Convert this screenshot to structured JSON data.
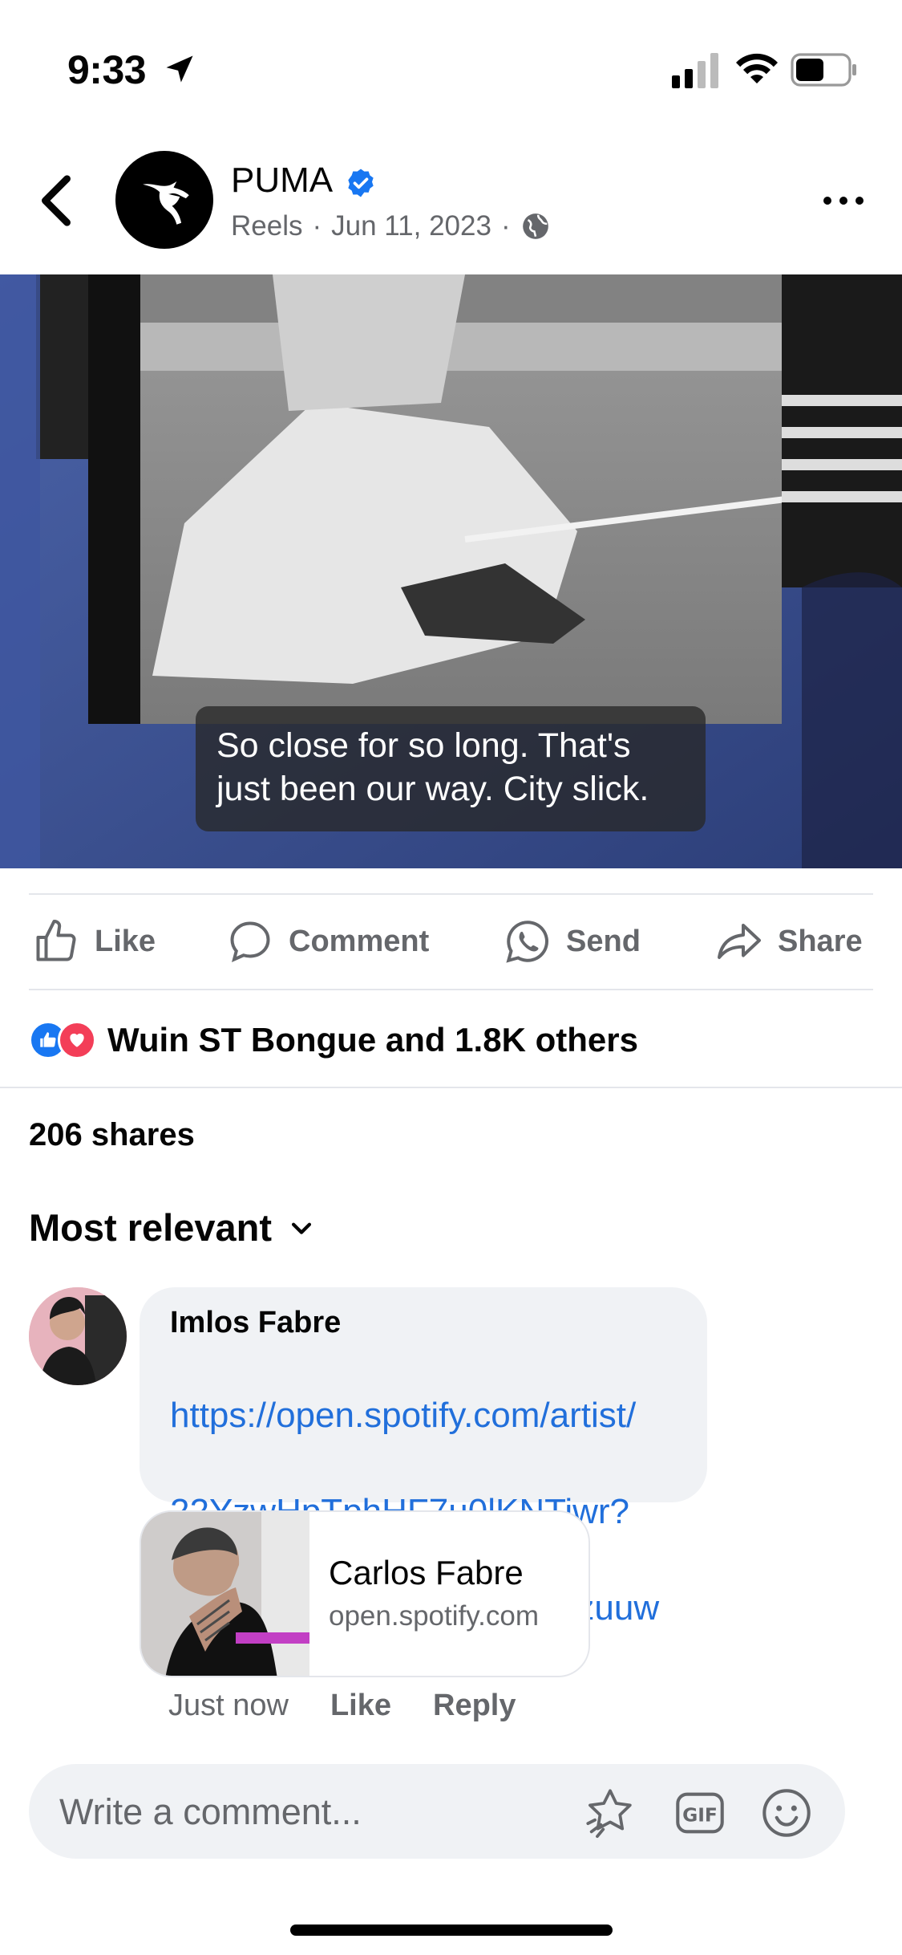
{
  "status_bar": {
    "time": "9:33"
  },
  "post": {
    "page_name": "PUMA",
    "source": "Reels",
    "date": "Jun 11, 2023",
    "separator": "·"
  },
  "video": {
    "caption_line1": "So close for so long. That's",
    "caption_line2": "just been our way. City slick."
  },
  "actions": {
    "like": "Like",
    "comment": "Comment",
    "send": "Send",
    "share": "Share"
  },
  "reactions": {
    "text": "Wuin ST Bongue and 1.8K others"
  },
  "shares": "206 shares",
  "sort": {
    "label": "Most relevant"
  },
  "comment": {
    "author": "Imlos Fabre",
    "link_line1": "https://open.spotify.com/artist/",
    "link_line2": "22YzwHpTphHF7u0lKNTiwr?",
    "link_line3": "si=KqTBcVetR9OtyKPMipzuuw",
    "preview_title": "Carlos Fabre",
    "preview_domain": "open.spotify.com",
    "time": "Just now",
    "like": "Like",
    "reply": "Reply"
  },
  "composer": {
    "placeholder": "Write a comment..."
  },
  "colors": {
    "accent": "#1877f2",
    "link": "#216fdb",
    "love": "#f33e58"
  }
}
